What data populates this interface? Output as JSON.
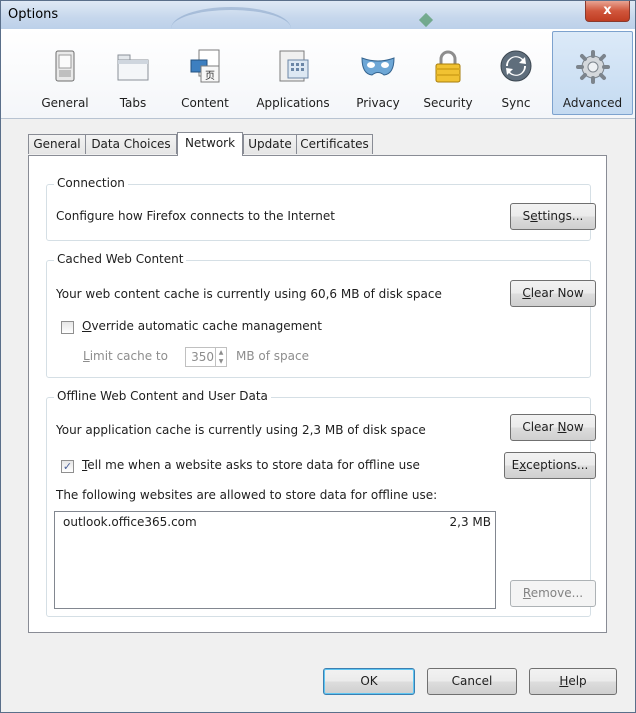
{
  "window": {
    "title": "Options",
    "close_glyph": "x"
  },
  "toolbar": {
    "items": [
      {
        "label": "General",
        "icon": "switch-icon"
      },
      {
        "label": "Tabs",
        "icon": "folder-tabs-icon"
      },
      {
        "label": "Content",
        "icon": "content-page-icon"
      },
      {
        "label": "Applications",
        "icon": "applications-icon"
      },
      {
        "label": "Privacy",
        "icon": "mask-icon"
      },
      {
        "label": "Security",
        "icon": "padlock-icon"
      },
      {
        "label": "Sync",
        "icon": "sync-icon"
      },
      {
        "label": "Advanced",
        "icon": "gear-icon"
      }
    ],
    "selected": "Advanced"
  },
  "tabs": {
    "items": [
      "General",
      "Data Choices",
      "Network",
      "Update",
      "Certificates"
    ],
    "active": "Network"
  },
  "connection": {
    "legend": "Connection",
    "description": "Configure how Firefox connects to the Internet",
    "settings_button": {
      "pre": "S",
      "key": "e",
      "post": "ttings..."
    }
  },
  "cache": {
    "legend": "Cached Web Content",
    "usage_text": "Your web content cache is currently using 60,6 MB of disk space",
    "clear_button": {
      "pre": "",
      "key": "C",
      "post": "lear Now"
    },
    "override_checkbox": {
      "pre": "",
      "key": "O",
      "post": "verride automatic cache management",
      "checked": false
    },
    "limit_label": {
      "pre": "",
      "key": "L",
      "post": "imit cache to"
    },
    "limit_value": "350",
    "limit_unit": "MB of space"
  },
  "offline": {
    "legend": "Offline Web Content and User Data",
    "usage_text": "Your application cache is currently using 2,3 MB of disk space",
    "clear_button": {
      "pre": "Clear ",
      "key": "N",
      "post": "ow"
    },
    "tell_checkbox": {
      "pre": "",
      "key": "T",
      "post": "ell me when a website asks to store data for offline use",
      "checked": true,
      "check_glyph": "✓"
    },
    "exceptions_button": {
      "pre": "E",
      "key": "x",
      "post": "ceptions..."
    },
    "list_caption": "The following websites are allowed to store data for offline use:",
    "sites": [
      {
        "site": "outlook.office365.com",
        "size": "2,3 MB"
      }
    ],
    "remove_button": {
      "pre": "",
      "key": "R",
      "post": "emove..."
    }
  },
  "footer": {
    "ok": "OK",
    "cancel": "Cancel",
    "help": {
      "pre": "",
      "key": "H",
      "post": "elp"
    }
  },
  "colors": {
    "accent": "#3c7fb1",
    "close_red": "#c03d22",
    "selected_tab_bg": "#c4daf1"
  }
}
